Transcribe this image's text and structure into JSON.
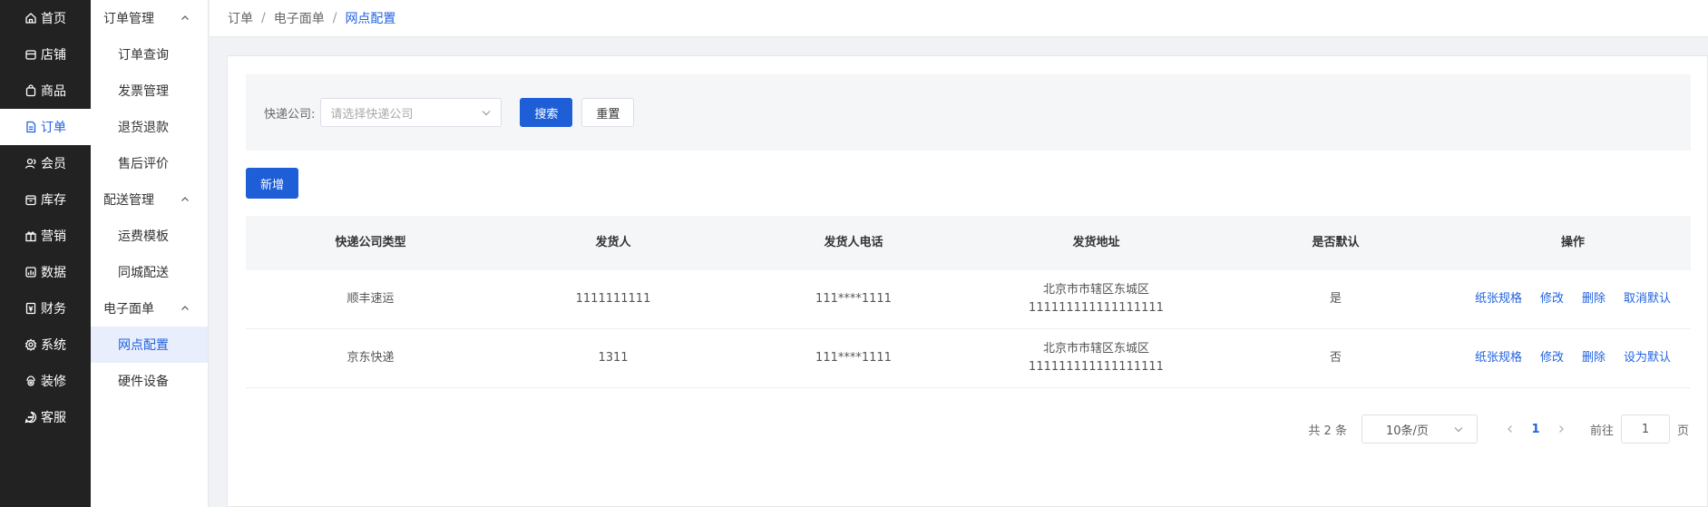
{
  "nav": {
    "items": [
      {
        "label": "首页",
        "icon": "home-icon"
      },
      {
        "label": "店铺",
        "icon": "shop-icon"
      },
      {
        "label": "商品",
        "icon": "bag-icon"
      },
      {
        "label": "订单",
        "icon": "document-icon",
        "active": true
      },
      {
        "label": "会员",
        "icon": "user-icon"
      },
      {
        "label": "库存",
        "icon": "box-icon"
      },
      {
        "label": "营销",
        "icon": "gift-icon"
      },
      {
        "label": "数据",
        "icon": "chart-icon"
      },
      {
        "label": "财务",
        "icon": "receipt-icon"
      },
      {
        "label": "系统",
        "icon": "gear-icon"
      },
      {
        "label": "装修",
        "icon": "brush-icon"
      },
      {
        "label": "客服",
        "icon": "chat-icon"
      }
    ]
  },
  "subnav": {
    "groups": [
      {
        "label": "订单管理",
        "items": [
          "订单查询",
          "发票管理",
          "退货退款",
          "售后评价"
        ]
      },
      {
        "label": "配送管理",
        "items": [
          "运费模板",
          "同城配送"
        ]
      },
      {
        "label": "电子面单",
        "items": [
          "网点配置",
          "硬件设备"
        ]
      }
    ],
    "active_item": "网点配置"
  },
  "breadcrumb": {
    "items": [
      "订单",
      "电子面单",
      "网点配置"
    ],
    "separator": "/"
  },
  "filter": {
    "label": "快递公司:",
    "placeholder": "请选择快递公司",
    "search_label": "搜索",
    "reset_label": "重置"
  },
  "add_label": "新增",
  "table": {
    "headers": [
      "快递公司类型",
      "发货人",
      "发货人电话",
      "发货地址",
      "是否默认",
      "操作"
    ],
    "rows": [
      {
        "company": "顺丰速运",
        "sender": "1111111111",
        "phone": "111****1111",
        "address_line1": "北京市市辖区东城区",
        "address_line2": "111111111111111111",
        "is_default": "是",
        "ops": [
          "纸张规格",
          "修改",
          "删除",
          "取消默认"
        ]
      },
      {
        "company": "京东快递",
        "sender": "1311",
        "phone": "111****1111",
        "address_line1": "北京市市辖区东城区",
        "address_line2": "111111111111111111",
        "is_default": "否",
        "ops": [
          "纸张规格",
          "修改",
          "删除",
          "设为默认"
        ]
      }
    ]
  },
  "pagination": {
    "total": "共 2 条",
    "page_size": "10条/页",
    "current_page": "1",
    "goto_label": "前往",
    "goto_value": "1",
    "unit": "页"
  },
  "colors": {
    "accent": "#1e5fd8",
    "nav_bg": "#222222",
    "active_sub_bg": "#e8eefc"
  }
}
